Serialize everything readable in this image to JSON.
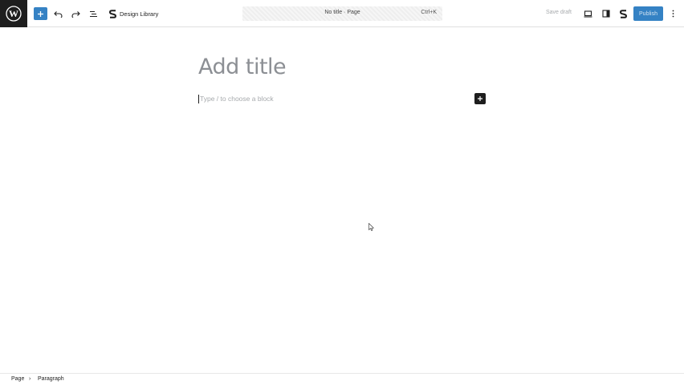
{
  "toolbar": {
    "design_library_label": "Design Library",
    "document_title": "No title · Page",
    "command_shortcut": "Ctrl+K",
    "save_draft_label": "Save draft",
    "publish_label": "Publish"
  },
  "editor": {
    "title_placeholder": "Add title",
    "paragraph_placeholder": "Type / to choose a block"
  },
  "breadcrumb": {
    "items": [
      "Page",
      "Paragraph"
    ],
    "separator": "›"
  },
  "colors": {
    "accent": "#3582c4",
    "dark": "#1e1e1e",
    "placeholder": "#8c8f94"
  }
}
